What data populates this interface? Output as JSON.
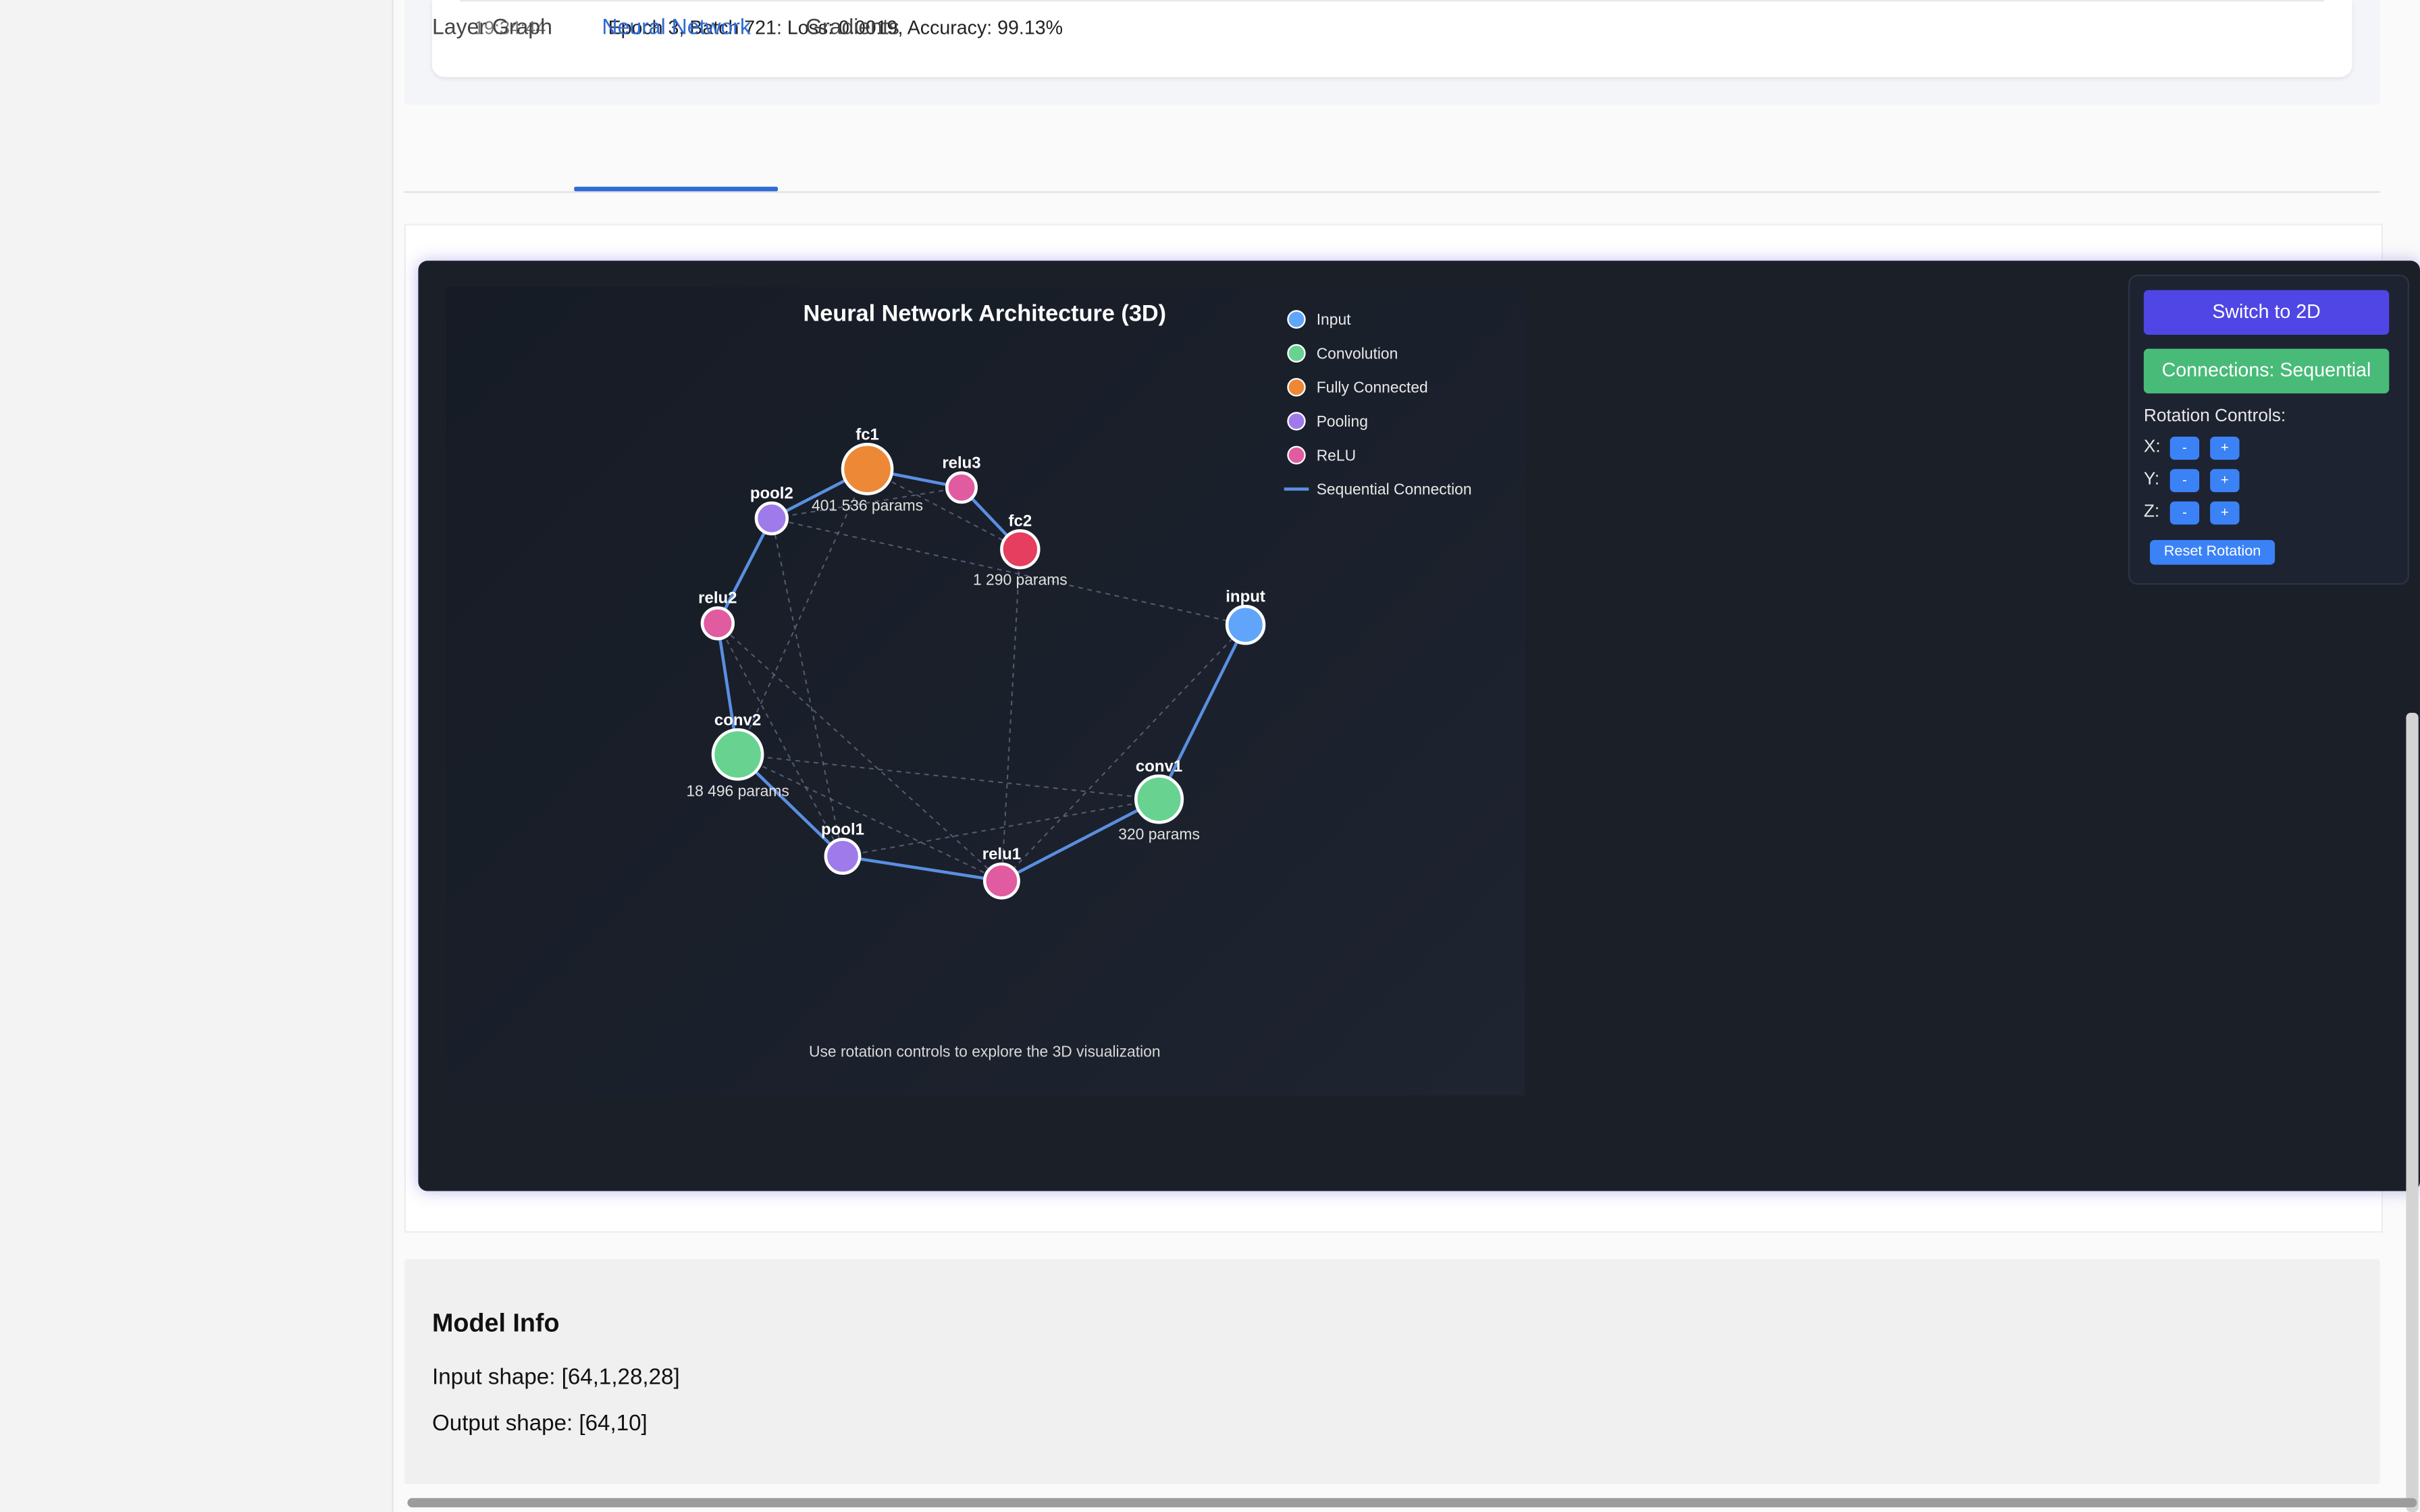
{
  "log": {
    "time": "19:34:44",
    "message": "Epoch 3, Batch 721: Loss: 0.0019, Accuracy: 99.13%"
  },
  "tabs": [
    {
      "label": "Layer Graph",
      "active": false
    },
    {
      "label": "Neural Network",
      "active": true
    },
    {
      "label": "Gradients",
      "active": false
    }
  ],
  "viz": {
    "title": "Neural Network Architecture (3D)",
    "hint": "Use rotation controls to explore the 3D visualization",
    "legend": [
      {
        "label": "Input",
        "color": "#60a5fa"
      },
      {
        "label": "Convolution",
        "color": "#68d391"
      },
      {
        "label": "Fully Connected",
        "color": "#ed8936"
      },
      {
        "label": "Pooling",
        "color": "#9f7aea"
      },
      {
        "label": "ReLU",
        "color": "#e15ba0"
      },
      {
        "label": "Sequential Connection",
        "color": "#5a8fe0"
      }
    ],
    "nodes": [
      {
        "id": "input",
        "label": "input",
        "type": "Input",
        "params": ""
      },
      {
        "id": "conv1",
        "label": "conv1",
        "type": "Convolution",
        "params": "320 params"
      },
      {
        "id": "relu1",
        "label": "relu1",
        "type": "ReLU",
        "params": ""
      },
      {
        "id": "pool1",
        "label": "pool1",
        "type": "Pooling",
        "params": ""
      },
      {
        "id": "conv2",
        "label": "conv2",
        "type": "Convolution",
        "params": "18 496 params"
      },
      {
        "id": "relu2",
        "label": "relu2",
        "type": "ReLU",
        "params": ""
      },
      {
        "id": "pool2",
        "label": "pool2",
        "type": "Pooling",
        "params": ""
      },
      {
        "id": "fc1",
        "label": "fc1",
        "type": "Fully Connected",
        "params": "401 536 params"
      },
      {
        "id": "relu3",
        "label": "relu3",
        "type": "ReLU",
        "params": ""
      },
      {
        "id": "fc2",
        "label": "fc2",
        "type": "Output",
        "params": "1 290 params"
      }
    ],
    "type_colors": {
      "Input": "#60a5fa",
      "Convolution": "#68d391",
      "Fully Connected": "#ed8936",
      "Pooling": "#9f7aea",
      "ReLU": "#e15ba0",
      "Output": "#e53e5e"
    }
  },
  "controls": {
    "switch_label": "Switch to 2D",
    "connections_label": "Connections: Sequential",
    "rotation_title": "Rotation Controls:",
    "axes": [
      {
        "label": "X:",
        "minus": "-",
        "plus": "+"
      },
      {
        "label": "Y:",
        "minus": "-",
        "plus": "+"
      },
      {
        "label": "Z:",
        "minus": "-",
        "plus": "+"
      }
    ],
    "reset_label": "Reset Rotation"
  },
  "model_info": {
    "title": "Model Info",
    "input_shape": "Input shape: [64,1,28,28]",
    "output_shape": "Output shape: [64,10]"
  }
}
